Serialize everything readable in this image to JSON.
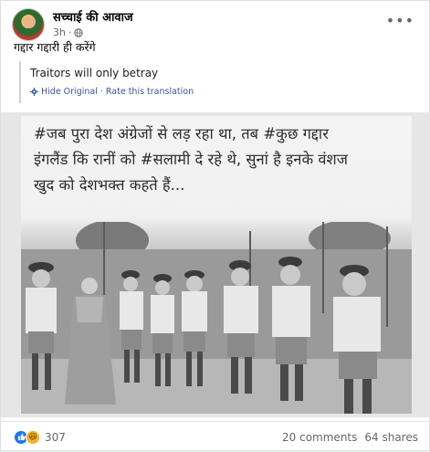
{
  "post": {
    "page_name": "सच्चाई की आवाज",
    "time": "3h",
    "text": "गद्दार गद्दारी ही करेंगे"
  },
  "translation": {
    "text": "Traitors will only betray",
    "hide_label": "Hide Original",
    "separator": "·",
    "rate_label": "Rate this translation"
  },
  "image": {
    "caption_line1": "#जब पुरा देश अंग्रेजों से लड़ रहा था, तब #कुछ गद्दार",
    "caption_line2": "इंगलैंड कि रानीं को #सलामी दे रहे थे, सुनां है इनके वंशज",
    "caption_line3": "खुद को देशभक्त कहते हैं..."
  },
  "stats": {
    "reactions_count": "307",
    "comments": "20 comments",
    "shares": "64 shares"
  },
  "icons": {
    "globe": "globe-icon",
    "more": "more-options-icon",
    "like": "like-reaction-icon",
    "haha": "haha-reaction-icon"
  }
}
